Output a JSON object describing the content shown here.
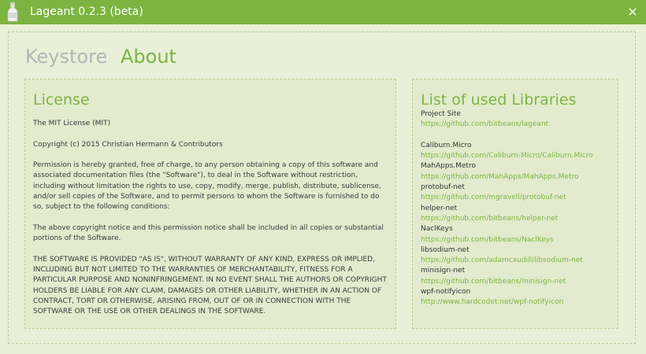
{
  "window": {
    "title": "Lageant 0.2.3 (beta)",
    "close_glyph": "×",
    "accent_color": "#7db441"
  },
  "tabs": [
    {
      "label": "Keystore",
      "active": false
    },
    {
      "label": "About",
      "active": true
    }
  ],
  "license": {
    "heading": "License",
    "paragraphs": [
      "The MIT License (MIT)",
      "Copyright (c) 2015 Christian Hermann & Contributors",
      "Permission is hereby granted, free of charge, to any person obtaining a copy of this software and associated documentation files (the \"Software\"), to deal in the Software without restriction, including without limitation the rights to use, copy, modify, merge, publish, distribute, sublicense, and/or sell copies of the Software, and to permit persons to whom the Software is furnished to do so, subject to the following conditions:",
      "The above copyright notice and this permission notice shall be included in all copies or substantial portions of the Software.",
      "THE SOFTWARE IS PROVIDED \"AS IS\", WITHOUT WARRANTY OF ANY KIND, EXPRESS OR IMPLIED, INCLUDING BUT NOT LIMITED TO THE WARRANTIES OF MERCHANTABILITY, FITNESS FOR A PARTICULAR PURPOSE AND NONINFRINGEMENT. IN NO EVENT SHALL THE AUTHORS OR COPYRIGHT HOLDERS BE LIABLE FOR ANY CLAIM, DAMAGES OR OTHER LIABILITY, WHETHER IN AN ACTION OF CONTRACT, TORT OR OTHERWISE, ARISING FROM, OUT OF OR IN CONNECTION WITH THE SOFTWARE OR THE USE OR OTHER DEALINGS IN THE SOFTWARE."
    ]
  },
  "libraries": {
    "heading": "List of used Libraries",
    "project": {
      "name": "Project Site",
      "url": "https://github.com/bitbeans/lageant"
    },
    "items": [
      {
        "name": "Caliburn.Micro",
        "url": "https://github.com/Caliburn-Micro/Caliburn.Micro"
      },
      {
        "name": "MahApps.Metro",
        "url": "https://github.com/MahApps/MahApps.Metro"
      },
      {
        "name": "protobuf-net",
        "url": "https://github.com/mgravell/protobuf-net"
      },
      {
        "name": "helper-net",
        "url": "https://github.com/bitbeans/helper-net"
      },
      {
        "name": "NaclKeys",
        "url": "https://github.com/bitbeans/NaclKeys"
      },
      {
        "name": "libsodium-net",
        "url": "https://github.com/adamcaudill/libsodium-net"
      },
      {
        "name": "minisign-net",
        "url": "https://github.com/bitbeans/minisign-net"
      },
      {
        "name": "wpf-notifyicon",
        "url": "http://www.hardcodet.net/wpf-notifyicon"
      }
    ]
  }
}
